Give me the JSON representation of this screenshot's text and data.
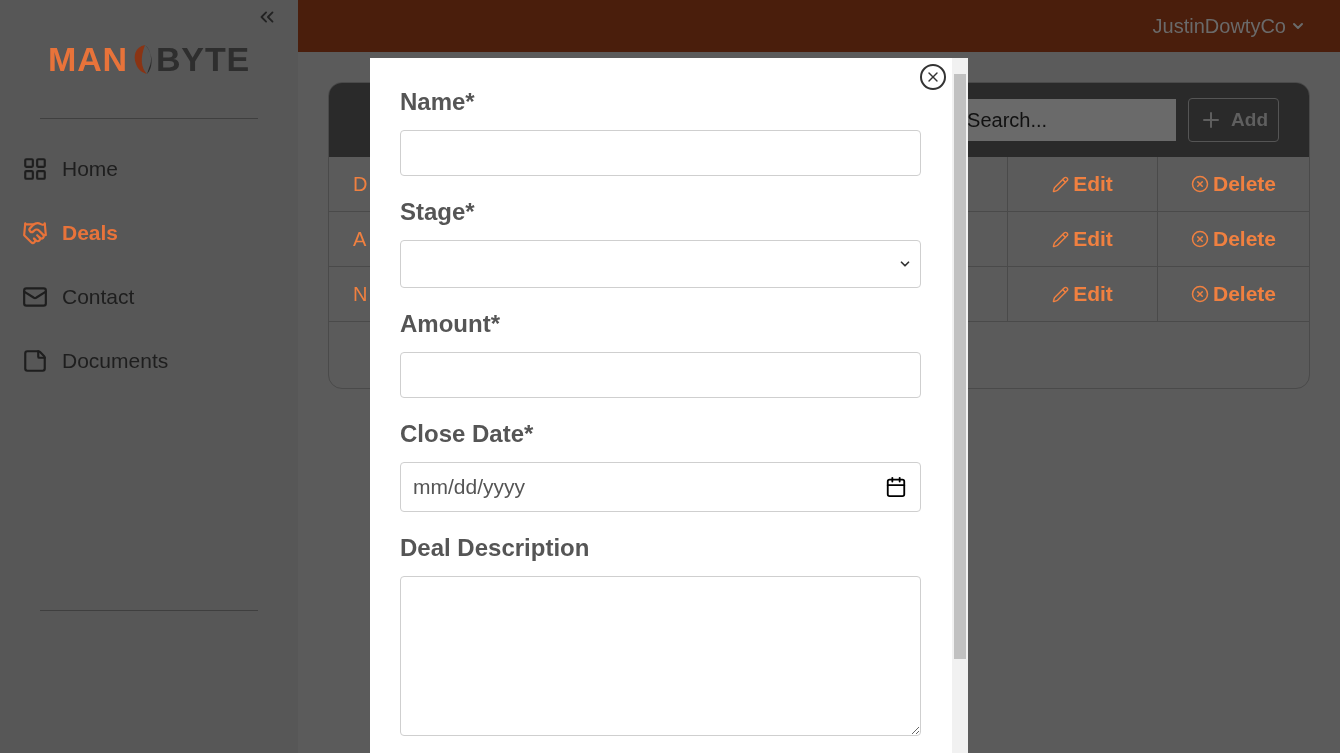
{
  "sidebar": {
    "logo": {
      "left": "MAN",
      "right": "BYTE"
    },
    "items": [
      {
        "label": "Home",
        "selected": false
      },
      {
        "label": "Deals",
        "selected": true
      },
      {
        "label": "Contact",
        "selected": false
      },
      {
        "label": "Documents",
        "selected": false
      }
    ]
  },
  "header": {
    "user": "JustinDowtyCo"
  },
  "table": {
    "search": {
      "placeholder": "Search..."
    },
    "add_button": "Add",
    "rows": [
      {
        "column_1": "D",
        "edit": "Edit",
        "delete": "Delete"
      },
      {
        "column_1": "A",
        "edit": "Edit",
        "delete": "Delete"
      },
      {
        "column_1": "N",
        "edit": "Edit",
        "delete": "Delete"
      }
    ]
  },
  "modal": {
    "fields": [
      {
        "label": "Name*",
        "kind": "text"
      },
      {
        "label": "Stage*",
        "kind": "select"
      },
      {
        "label": "Amount*",
        "kind": "text"
      },
      {
        "label": "Close Date*",
        "kind": "date",
        "placeholder": "mm/dd/yyyy"
      },
      {
        "label": "Deal Description",
        "kind": "textarea"
      }
    ]
  }
}
